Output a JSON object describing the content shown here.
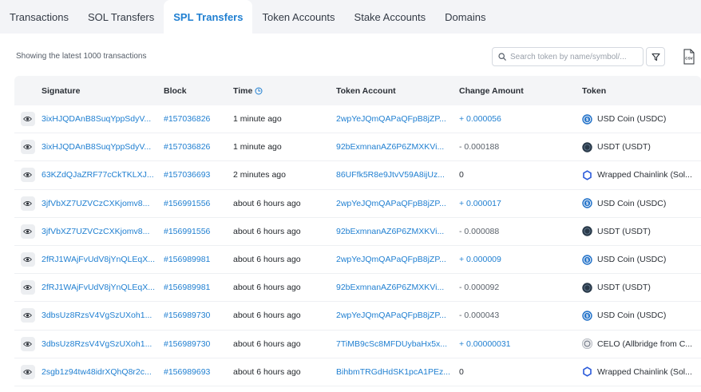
{
  "tabs": [
    {
      "label": "Transactions",
      "active": false
    },
    {
      "label": "SOL Transfers",
      "active": false
    },
    {
      "label": "SPL Transfers",
      "active": true
    },
    {
      "label": "Token Accounts",
      "active": false
    },
    {
      "label": "Stake Accounts",
      "active": false
    },
    {
      "label": "Domains",
      "active": false
    }
  ],
  "panel": {
    "showing_text": "Showing the latest 1000 transactions",
    "search_placeholder": "Search token by name/symbol/...",
    "filter_icon": "filter-icon",
    "export_icon": "csv-download-icon"
  },
  "table": {
    "headers": {
      "signature": "Signature",
      "block": "Block",
      "time": "Time",
      "token_account": "Token Account",
      "change_amount": "Change Amount",
      "token": "Token"
    },
    "colors": {
      "link": "#1f7fd1",
      "positive": "#1f7fd1",
      "negative": "#5b626b",
      "active_tab": "#1f7fd1"
    },
    "rows": [
      {
        "signature": "3ixHJQDAnB8SuqYppSdyV...",
        "block": "#157036826",
        "time": "1 minute ago",
        "account": "2wpYeJQmQAPaQFpB8jZP...",
        "amount": "+ 0.000056",
        "sign": "pos",
        "token": "USD Coin (USDC)",
        "icon": "usdc"
      },
      {
        "signature": "3ixHJQDAnB8SuqYppSdyV...",
        "block": "#157036826",
        "time": "1 minute ago",
        "account": "92bExmnanAZ6P6ZMXKVi...",
        "amount": "- 0.000188",
        "sign": "neg",
        "token": "USDT (USDT)",
        "icon": "usdt"
      },
      {
        "signature": "63KZdQJaZRF77cCkTKLXJ...",
        "block": "#157036693",
        "time": "2 minutes ago",
        "account": "86UFfk5R8e9JtvV59A8ijUz...",
        "amount": "0",
        "sign": "zero",
        "token": "Wrapped Chainlink (Sol...",
        "icon": "link"
      },
      {
        "signature": "3jfVbXZ7UZVCzCXKjomv8...",
        "block": "#156991556",
        "time": "about 6 hours ago",
        "account": "2wpYeJQmQAPaQFpB8jZP...",
        "amount": "+ 0.000017",
        "sign": "pos",
        "token": "USD Coin (USDC)",
        "icon": "usdc"
      },
      {
        "signature": "3jfVbXZ7UZVCzCXKjomv8...",
        "block": "#156991556",
        "time": "about 6 hours ago",
        "account": "92bExmnanAZ6P6ZMXKVi...",
        "amount": "- 0.000088",
        "sign": "neg",
        "token": "USDT (USDT)",
        "icon": "usdt"
      },
      {
        "signature": "2fRJ1WAjFvUdV8jYnQLEqX...",
        "block": "#156989981",
        "time": "about 6 hours ago",
        "account": "2wpYeJQmQAPaQFpB8jZP...",
        "amount": "+ 0.000009",
        "sign": "pos",
        "token": "USD Coin (USDC)",
        "icon": "usdc"
      },
      {
        "signature": "2fRJ1WAjFvUdV8jYnQLEqX...",
        "block": "#156989981",
        "time": "about 6 hours ago",
        "account": "92bExmnanAZ6P6ZMXKVi...",
        "amount": "- 0.000092",
        "sign": "neg",
        "token": "USDT (USDT)",
        "icon": "usdt"
      },
      {
        "signature": "3dbsUz8RzsV4VgSzUXoh1...",
        "block": "#156989730",
        "time": "about 6 hours ago",
        "account": "2wpYeJQmQAPaQFpB8jZP...",
        "amount": "- 0.000043",
        "sign": "neg",
        "token": "USD Coin (USDC)",
        "icon": "usdc"
      },
      {
        "signature": "3dbsUz8RzsV4VgSzUXoh1...",
        "block": "#156989730",
        "time": "about 6 hours ago",
        "account": "7TiMB9cSc8MFDUybaHx5x...",
        "amount": "+ 0.00000031",
        "sign": "pos",
        "token": "CELO (Allbridge from C...",
        "icon": "celo"
      },
      {
        "signature": "2sgb1z94tw48idrXQhQ8r2c...",
        "block": "#156989693",
        "time": "about 6 hours ago",
        "account": "BihbmTRGdHdSK1pcA1PEz...",
        "amount": "0",
        "sign": "zero",
        "token": "Wrapped Chainlink (Sol...",
        "icon": "link"
      }
    ]
  }
}
